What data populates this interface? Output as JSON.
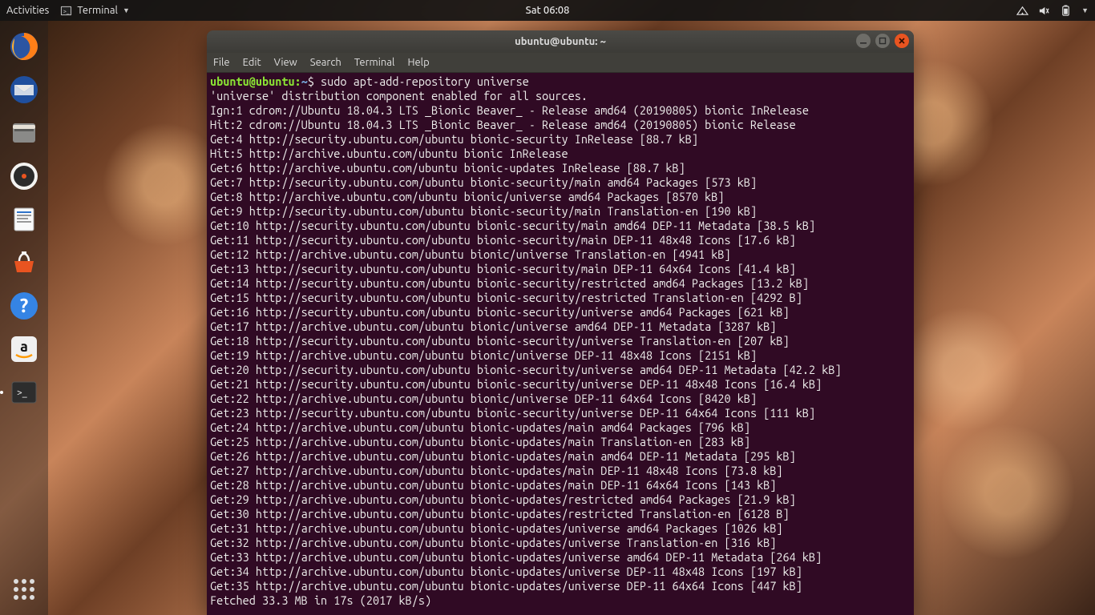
{
  "topbar": {
    "activities": "Activities",
    "app_name": "Terminal",
    "clock": "Sat 06:08"
  },
  "dock_icons": [
    "firefox",
    "thunderbird",
    "files",
    "rhythmbox",
    "writer",
    "software",
    "help",
    "amazon",
    "terminal"
  ],
  "window": {
    "title": "ubuntu@ubuntu: ~",
    "menu": [
      "File",
      "Edit",
      "View",
      "Search",
      "Terminal",
      "Help"
    ]
  },
  "prompt": {
    "user_host": "ubuntu@ubuntu:",
    "cwd": "~",
    "sigil": "$"
  },
  "command": "sudo apt-add-repository universe",
  "output": [
    "'universe' distribution component enabled for all sources.",
    "Ign:1 cdrom://Ubuntu 18.04.3 LTS _Bionic Beaver_ - Release amd64 (20190805) bionic InRelease",
    "Hit:2 cdrom://Ubuntu 18.04.3 LTS _Bionic Beaver_ - Release amd64 (20190805) bionic Release",
    "Get:4 http://security.ubuntu.com/ubuntu bionic-security InRelease [88.7 kB]",
    "Hit:5 http://archive.ubuntu.com/ubuntu bionic InRelease",
    "Get:6 http://archive.ubuntu.com/ubuntu bionic-updates InRelease [88.7 kB]",
    "Get:7 http://security.ubuntu.com/ubuntu bionic-security/main amd64 Packages [573 kB]",
    "Get:8 http://archive.ubuntu.com/ubuntu bionic/universe amd64 Packages [8570 kB]",
    "Get:9 http://security.ubuntu.com/ubuntu bionic-security/main Translation-en [190 kB]",
    "Get:10 http://security.ubuntu.com/ubuntu bionic-security/main amd64 DEP-11 Metadata [38.5 kB]",
    "Get:11 http://security.ubuntu.com/ubuntu bionic-security/main DEP-11 48x48 Icons [17.6 kB]",
    "Get:12 http://archive.ubuntu.com/ubuntu bionic/universe Translation-en [4941 kB]",
    "Get:13 http://security.ubuntu.com/ubuntu bionic-security/main DEP-11 64x64 Icons [41.4 kB]",
    "Get:14 http://security.ubuntu.com/ubuntu bionic-security/restricted amd64 Packages [13.2 kB]",
    "Get:15 http://security.ubuntu.com/ubuntu bionic-security/restricted Translation-en [4292 B]",
    "Get:16 http://security.ubuntu.com/ubuntu bionic-security/universe amd64 Packages [621 kB]",
    "Get:17 http://archive.ubuntu.com/ubuntu bionic/universe amd64 DEP-11 Metadata [3287 kB]",
    "Get:18 http://security.ubuntu.com/ubuntu bionic-security/universe Translation-en [207 kB]",
    "Get:19 http://archive.ubuntu.com/ubuntu bionic/universe DEP-11 48x48 Icons [2151 kB]",
    "Get:20 http://security.ubuntu.com/ubuntu bionic-security/universe amd64 DEP-11 Metadata [42.2 kB]",
    "Get:21 http://security.ubuntu.com/ubuntu bionic-security/universe DEP-11 48x48 Icons [16.4 kB]",
    "Get:22 http://archive.ubuntu.com/ubuntu bionic/universe DEP-11 64x64 Icons [8420 kB]",
    "Get:23 http://security.ubuntu.com/ubuntu bionic-security/universe DEP-11 64x64 Icons [111 kB]",
    "Get:24 http://archive.ubuntu.com/ubuntu bionic-updates/main amd64 Packages [796 kB]",
    "Get:25 http://archive.ubuntu.com/ubuntu bionic-updates/main Translation-en [283 kB]",
    "Get:26 http://archive.ubuntu.com/ubuntu bionic-updates/main amd64 DEP-11 Metadata [295 kB]",
    "Get:27 http://archive.ubuntu.com/ubuntu bionic-updates/main DEP-11 48x48 Icons [73.8 kB]",
    "Get:28 http://archive.ubuntu.com/ubuntu bionic-updates/main DEP-11 64x64 Icons [143 kB]",
    "Get:29 http://archive.ubuntu.com/ubuntu bionic-updates/restricted amd64 Packages [21.9 kB]",
    "Get:30 http://archive.ubuntu.com/ubuntu bionic-updates/restricted Translation-en [6128 B]",
    "Get:31 http://archive.ubuntu.com/ubuntu bionic-updates/universe amd64 Packages [1026 kB]",
    "Get:32 http://archive.ubuntu.com/ubuntu bionic-updates/universe Translation-en [316 kB]",
    "Get:33 http://archive.ubuntu.com/ubuntu bionic-updates/universe amd64 DEP-11 Metadata [264 kB]",
    "Get:34 http://archive.ubuntu.com/ubuntu bionic-updates/universe DEP-11 48x48 Icons [197 kB]",
    "Get:35 http://archive.ubuntu.com/ubuntu bionic-updates/universe DEP-11 64x64 Icons [447 kB]",
    "Fetched 33.3 MB in 17s (2017 kB/s)"
  ]
}
